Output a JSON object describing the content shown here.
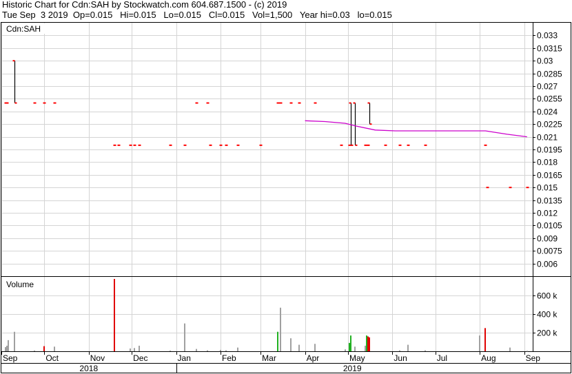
{
  "header": {
    "line1": "Historic Chart for Cdn:SAH by Stockwatch.com 604.687.1500 - (c) 2019",
    "line2": "Tue Sep  3 2019  Op=0.015   Hi=0.015   Lo=0.015   Cl=0.015   Vol=1,500   Year hi=0.03   lo=0.015"
  },
  "chart_data": [
    {
      "type": "ohlc",
      "title": "Cdn:SAH",
      "ylim": [
        0.0045,
        0.0345
      ],
      "y_ticks": [
        "0.033",
        "0.0315",
        "0.03",
        "0.0285",
        "0.027",
        "0.0255",
        "0.024",
        "0.0225",
        "0.021",
        "0.0195",
        "0.018",
        "0.0165",
        "0.015",
        "0.0135",
        "0.012",
        "0.0105",
        "0.009",
        "0.0075",
        "0.006"
      ],
      "y_tick_values": [
        0.033,
        0.0315,
        0.03,
        0.0285,
        0.027,
        0.0255,
        0.024,
        0.0225,
        0.021,
        0.0195,
        0.018,
        0.0165,
        0.015,
        0.0135,
        0.012,
        0.0105,
        0.009,
        0.0075,
        0.006
      ],
      "grid": true,
      "bars": [
        {
          "date": "2018-09-04",
          "high": 0.025,
          "low": 0.025
        },
        {
          "date": "2018-09-05",
          "high": 0.025,
          "low": 0.025
        },
        {
          "date": "2018-09-10",
          "high": 0.03,
          "low": 0.025
        },
        {
          "date": "2018-09-24",
          "high": 0.025,
          "low": 0.025
        },
        {
          "date": "2018-10-01",
          "high": 0.025,
          "low": 0.025
        },
        {
          "date": "2018-10-08",
          "high": 0.025,
          "low": 0.025
        },
        {
          "date": "2018-11-19",
          "high": 0.02,
          "low": 0.02
        },
        {
          "date": "2018-11-22",
          "high": 0.02,
          "low": 0.02
        },
        {
          "date": "2018-11-30",
          "high": 0.02,
          "low": 0.02
        },
        {
          "date": "2018-12-03",
          "high": 0.02,
          "low": 0.02
        },
        {
          "date": "2018-12-06",
          "high": 0.02,
          "low": 0.02
        },
        {
          "date": "2018-12-28",
          "high": 0.02,
          "low": 0.02
        },
        {
          "date": "2019-01-07",
          "high": 0.02,
          "low": 0.02
        },
        {
          "date": "2019-01-15",
          "high": 0.025,
          "low": 0.025
        },
        {
          "date": "2019-01-23",
          "high": 0.025,
          "low": 0.025
        },
        {
          "date": "2019-01-25",
          "high": 0.02,
          "low": 0.02
        },
        {
          "date": "2019-02-01",
          "high": 0.02,
          "low": 0.02
        },
        {
          "date": "2019-02-05",
          "high": 0.02,
          "low": 0.02
        },
        {
          "date": "2019-02-13",
          "high": 0.02,
          "low": 0.02
        },
        {
          "date": "2019-03-01",
          "high": 0.02,
          "low": 0.02
        },
        {
          "date": "2019-03-13",
          "high": 0.025,
          "low": 0.025
        },
        {
          "date": "2019-03-15",
          "high": 0.025,
          "low": 0.025
        },
        {
          "date": "2019-03-22",
          "high": 0.025,
          "low": 0.025
        },
        {
          "date": "2019-03-28",
          "high": 0.025,
          "low": 0.025
        },
        {
          "date": "2019-04-08",
          "high": 0.025,
          "low": 0.025
        },
        {
          "date": "2019-04-26",
          "high": 0.02,
          "low": 0.02
        },
        {
          "date": "2019-05-02",
          "high": 0.02,
          "low": 0.02
        },
        {
          "date": "2019-05-03",
          "high": 0.025,
          "low": 0.02
        },
        {
          "date": "2019-05-06",
          "high": 0.025,
          "low": 0.02
        },
        {
          "date": "2019-05-13",
          "high": 0.02,
          "low": 0.02
        },
        {
          "date": "2019-05-15",
          "high": 0.02,
          "low": 0.02
        },
        {
          "date": "2019-05-16",
          "high": 0.025,
          "low": 0.0225
        },
        {
          "date": "2019-05-27",
          "high": 0.02,
          "low": 0.02
        },
        {
          "date": "2019-06-06",
          "high": 0.02,
          "low": 0.02
        },
        {
          "date": "2019-06-12",
          "high": 0.02,
          "low": 0.02
        },
        {
          "date": "2019-06-24",
          "high": 0.02,
          "low": 0.02
        },
        {
          "date": "2019-08-05",
          "high": 0.02,
          "low": 0.02
        },
        {
          "date": "2019-08-06",
          "high": 0.015,
          "low": 0.015
        },
        {
          "date": "2019-08-22",
          "high": 0.015,
          "low": 0.015
        },
        {
          "date": "2019-09-03",
          "high": 0.015,
          "low": 0.015
        }
      ],
      "moving_average": [
        {
          "date": "2019-04-01",
          "value": 0.0229
        },
        {
          "date": "2019-04-15",
          "value": 0.0228
        },
        {
          "date": "2019-04-29",
          "value": 0.0226
        },
        {
          "date": "2019-05-06",
          "value": 0.0223
        },
        {
          "date": "2019-05-20",
          "value": 0.0218
        },
        {
          "date": "2019-06-03",
          "value": 0.0217
        },
        {
          "date": "2019-07-01",
          "value": 0.0217
        },
        {
          "date": "2019-08-05",
          "value": 0.0217
        },
        {
          "date": "2019-08-20",
          "value": 0.0213
        },
        {
          "date": "2019-09-03",
          "value": 0.021
        }
      ],
      "colors": {
        "price": "#ff0000",
        "range": "#000000",
        "moving_average": "#cc00cc"
      }
    },
    {
      "type": "bar",
      "title": "Volume",
      "ylim": [
        0,
        780000
      ],
      "y_ticks": [
        "600 k",
        "400 k",
        "200 k"
      ],
      "y_tick_values": [
        600000,
        400000,
        200000
      ],
      "bars": [
        {
          "date": "2018-09-04",
          "value": 45000,
          "color": "gray"
        },
        {
          "date": "2018-09-05",
          "value": 60000,
          "color": "gray"
        },
        {
          "date": "2018-09-06",
          "value": 120000,
          "color": "gray"
        },
        {
          "date": "2018-09-10",
          "value": 210000,
          "color": "gray"
        },
        {
          "date": "2018-09-24",
          "value": 8000,
          "color": "gray"
        },
        {
          "date": "2018-10-01",
          "value": 55000,
          "color": "red"
        },
        {
          "date": "2018-10-08",
          "value": 50000,
          "color": "gray"
        },
        {
          "date": "2018-11-19",
          "value": 780000,
          "color": "red"
        },
        {
          "date": "2018-11-30",
          "value": 30000,
          "color": "gray"
        },
        {
          "date": "2018-12-03",
          "value": 35000,
          "color": "gray"
        },
        {
          "date": "2018-12-06",
          "value": 60000,
          "color": "gray"
        },
        {
          "date": "2018-12-28",
          "value": 8000,
          "color": "gray"
        },
        {
          "date": "2019-01-07",
          "value": 300000,
          "color": "gray"
        },
        {
          "date": "2019-01-15",
          "value": 25000,
          "color": "gray"
        },
        {
          "date": "2019-01-23",
          "value": 10000,
          "color": "gray"
        },
        {
          "date": "2019-02-01",
          "value": 15000,
          "color": "gray"
        },
        {
          "date": "2019-02-05",
          "value": 10000,
          "color": "gray"
        },
        {
          "date": "2019-02-13",
          "value": 40000,
          "color": "gray"
        },
        {
          "date": "2019-03-13",
          "value": 210000,
          "color": "green"
        },
        {
          "date": "2019-03-15",
          "value": 470000,
          "color": "gray"
        },
        {
          "date": "2019-03-22",
          "value": 140000,
          "color": "gray"
        },
        {
          "date": "2019-03-28",
          "value": 70000,
          "color": "gray"
        },
        {
          "date": "2019-04-08",
          "value": 80000,
          "color": "gray"
        },
        {
          "date": "2019-04-29",
          "value": 20000,
          "color": "gray"
        },
        {
          "date": "2019-05-02",
          "value": 90000,
          "color": "green"
        },
        {
          "date": "2019-05-03",
          "value": 170000,
          "color": "green"
        },
        {
          "date": "2019-05-06",
          "value": 50000,
          "color": "gray"
        },
        {
          "date": "2019-05-13",
          "value": 60000,
          "color": "gray"
        },
        {
          "date": "2019-05-14",
          "value": 170000,
          "color": "green"
        },
        {
          "date": "2019-05-15",
          "value": 160000,
          "color": "red"
        },
        {
          "date": "2019-05-16",
          "value": 150000,
          "color": "red"
        },
        {
          "date": "2019-06-06",
          "value": 10000,
          "color": "gray"
        },
        {
          "date": "2019-06-12",
          "value": 70000,
          "color": "gray"
        },
        {
          "date": "2019-06-24",
          "value": 10000,
          "color": "gray"
        },
        {
          "date": "2019-08-01",
          "value": 170000,
          "color": "gray"
        },
        {
          "date": "2019-08-05",
          "value": 250000,
          "color": "red"
        },
        {
          "date": "2019-08-22",
          "value": 40000,
          "color": "gray"
        },
        {
          "date": "2019-09-03",
          "value": 5000,
          "color": "gray"
        }
      ],
      "colors": {
        "gray": "#a0a0a0",
        "red": "#e00000",
        "green": "#20b020"
      }
    }
  ],
  "x_axis": {
    "months": [
      {
        "label": "Sep",
        "date": "2018-09-01"
      },
      {
        "label": "Oct",
        "date": "2018-10-01"
      },
      {
        "label": "Nov",
        "date": "2018-11-01"
      },
      {
        "label": "Dec",
        "date": "2018-12-01"
      },
      {
        "label": "Jan",
        "date": "2019-01-01"
      },
      {
        "label": "Feb",
        "date": "2019-02-01"
      },
      {
        "label": "Mar",
        "date": "2019-03-01"
      },
      {
        "label": "Apr",
        "date": "2019-04-01"
      },
      {
        "label": "May",
        "date": "2019-05-01"
      },
      {
        "label": "Jun",
        "date": "2019-06-01"
      },
      {
        "label": "Jul",
        "date": "2019-07-01"
      },
      {
        "label": "Aug",
        "date": "2019-08-01"
      },
      {
        "label": "Sep",
        "date": "2019-09-01"
      }
    ],
    "years": [
      {
        "label": "2018",
        "start": "2018-09-01",
        "end": "2019-01-01"
      },
      {
        "label": "2019",
        "start": "2019-01-01",
        "end": "2019-09-04"
      }
    ]
  }
}
